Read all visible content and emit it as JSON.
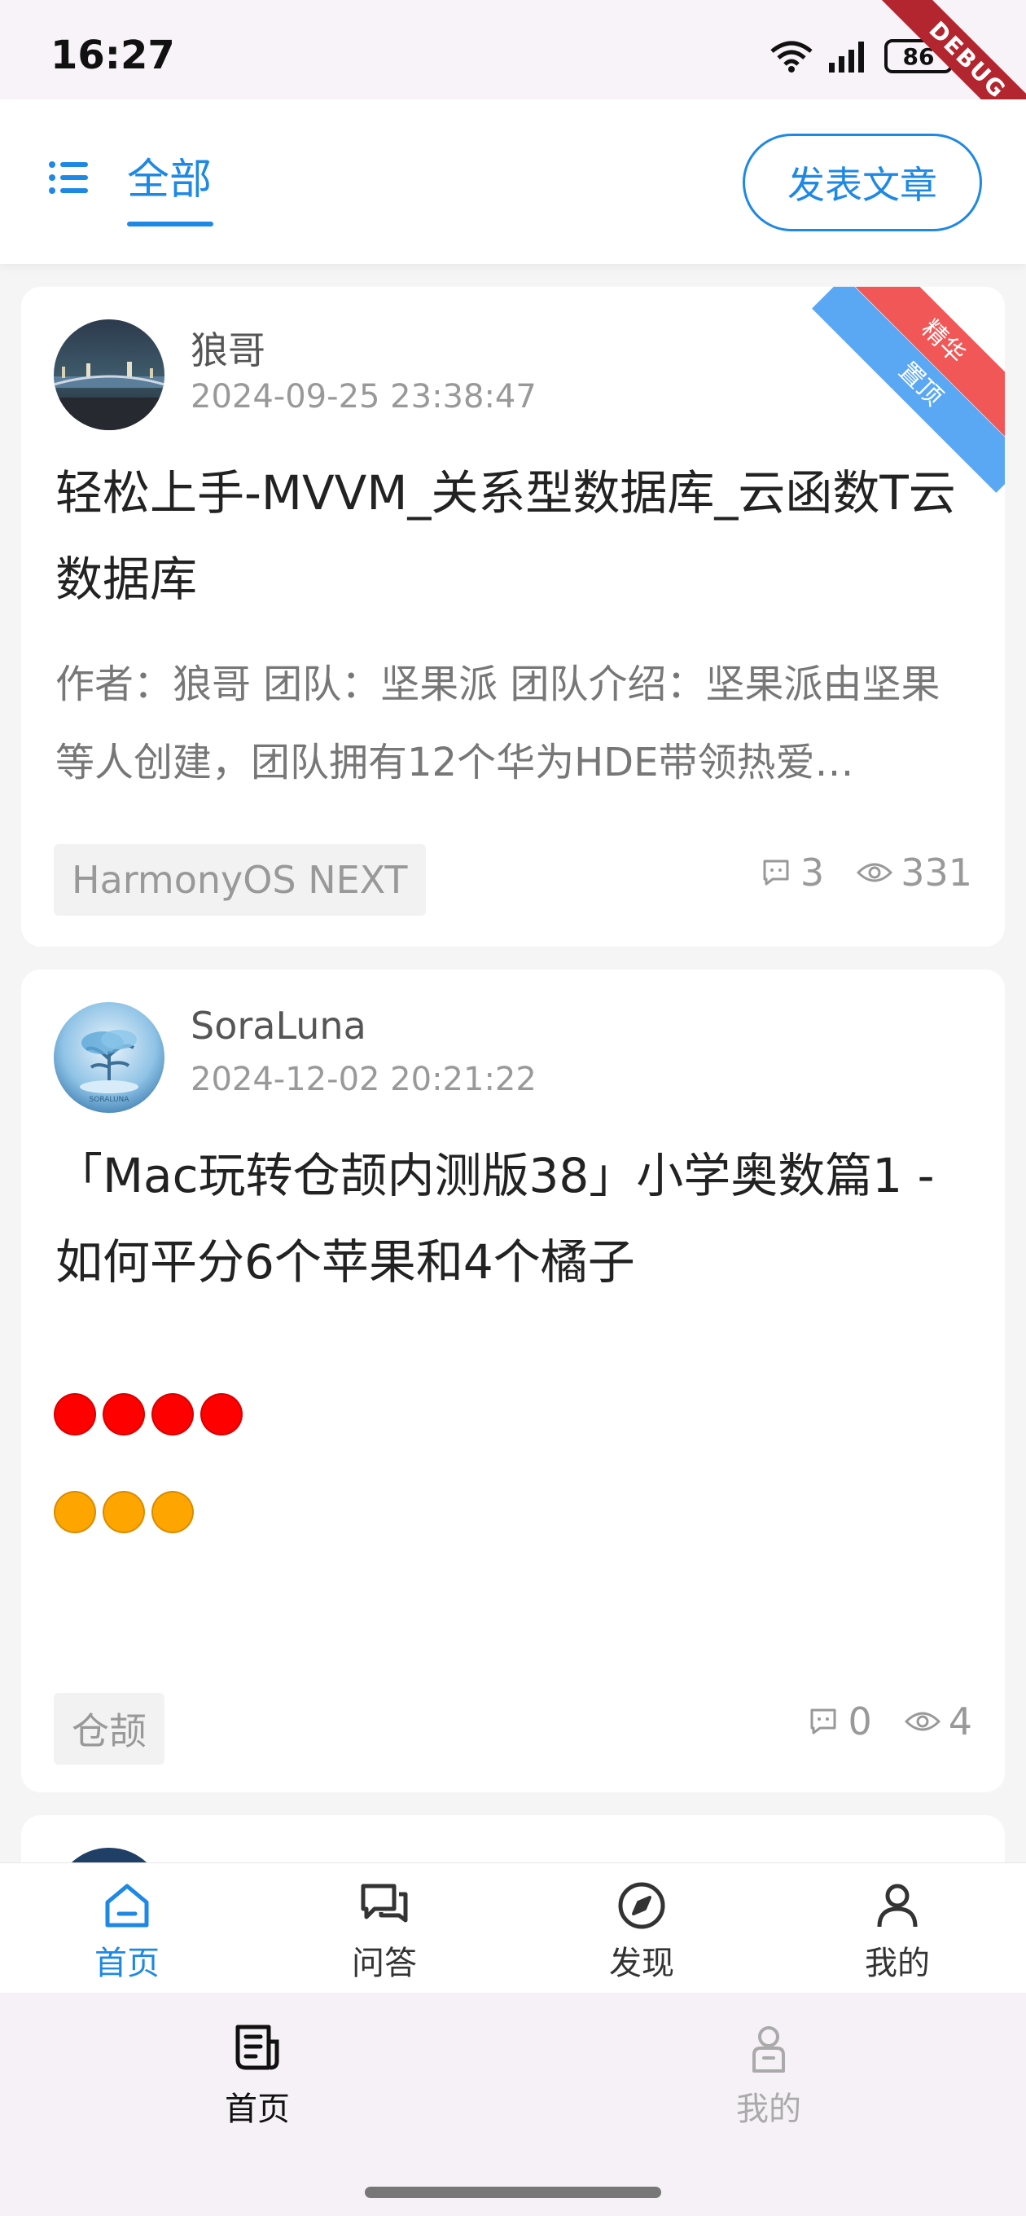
{
  "status_bar": {
    "time": "16:27",
    "battery": "86",
    "debug_banner": "DEBUG"
  },
  "top_bar": {
    "menu_icon": "list-icon",
    "tab_label": "全部",
    "publish_label": "发表文章",
    "accent_color": "#1e88e5"
  },
  "articles": [
    {
      "author": "狼哥",
      "time": "2024-09-25 23:38:47",
      "title": "轻松上手-MVVM_关系型数据库_云函数T云数据库",
      "summary": "作者：狼哥 团队：坚果派 团队介绍：坚果派由坚果等人创建，团队拥有12个华为HDE带领热爱…",
      "tag": "HarmonyOS NEXT",
      "comments": "3",
      "views": "331",
      "badges": [
        "精华",
        "置顶"
      ]
    },
    {
      "author": "SoraLuna",
      "time": "2024-12-02 20:21:22",
      "title": "「Mac玩转仓颉内测版38」小学奥数篇1 - 如何平分6个苹果和4个橘子",
      "tag": "仓颉",
      "comments": "0",
      "views": "4",
      "red_dots": 4,
      "orange_dots": 3
    }
  ],
  "inner_nav": [
    {
      "label": "首页",
      "icon": "home-icon",
      "active": true
    },
    {
      "label": "问答",
      "icon": "chat-icon",
      "active": false
    },
    {
      "label": "发现",
      "icon": "compass-icon",
      "active": false
    },
    {
      "label": "我的",
      "icon": "user-icon",
      "active": false
    }
  ],
  "bottom_nav": [
    {
      "label": "首页",
      "icon": "article-icon",
      "active": true
    },
    {
      "label": "我的",
      "icon": "profile-icon",
      "active": false
    }
  ]
}
